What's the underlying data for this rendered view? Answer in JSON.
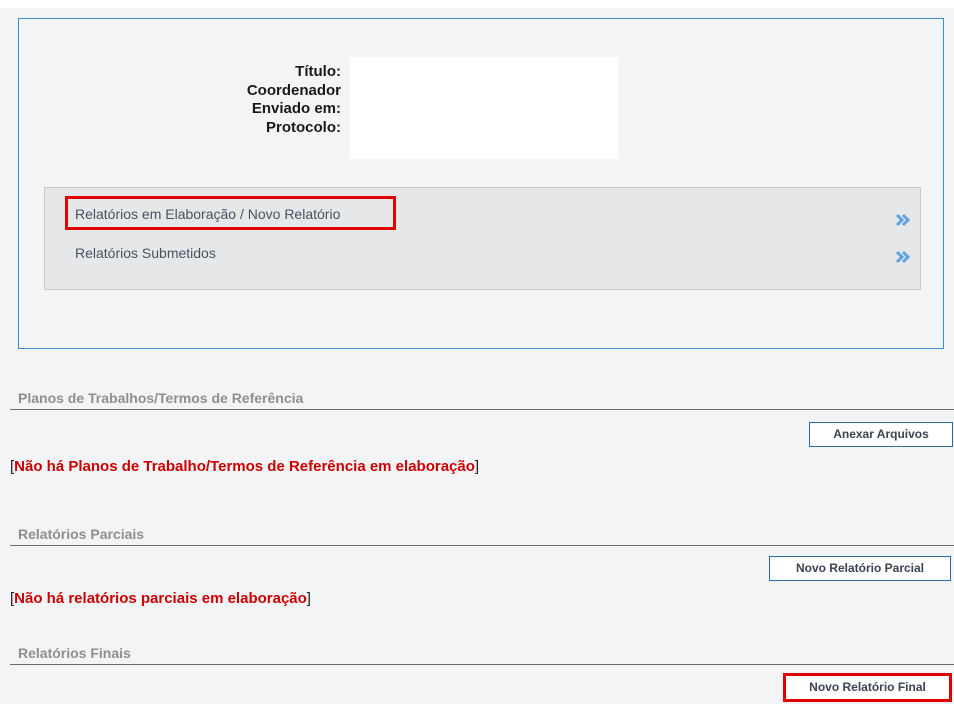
{
  "project_info": {
    "labels": {
      "titulo": "Título:",
      "coordenador": "Coordenador",
      "enviado_em": "Enviado em:",
      "protocolo": "Protocolo:"
    }
  },
  "nav": {
    "items": [
      {
        "label": "Relatórios em Elaboração / Novo Relatório",
        "icon": "double-chevron-right-icon"
      },
      {
        "label": "Relatórios Submetidos",
        "icon": "double-chevron-right-icon"
      }
    ]
  },
  "sections": {
    "planos": {
      "title": "Planos de Trabalhos/Termos de Referência",
      "button": "Anexar Arquivos",
      "empty_open": "[",
      "empty_text": "Não há Planos de Trabalho/Termos de Referência em elaboração",
      "empty_close": "]"
    },
    "parciais": {
      "title": "Relatórios Parciais",
      "button": "Novo Relatório Parcial",
      "empty_open": "[",
      "empty_text": "Não há relatórios parciais em elaboração",
      "empty_close": "]"
    },
    "finais": {
      "title": "Relatórios Finais",
      "button": "Novo Relatório Final"
    }
  },
  "colors": {
    "highlight": "#e00000",
    "panel_border": "#3d8ed0",
    "chevron": "#5fa3e0",
    "empty_message": "#cc0000"
  }
}
